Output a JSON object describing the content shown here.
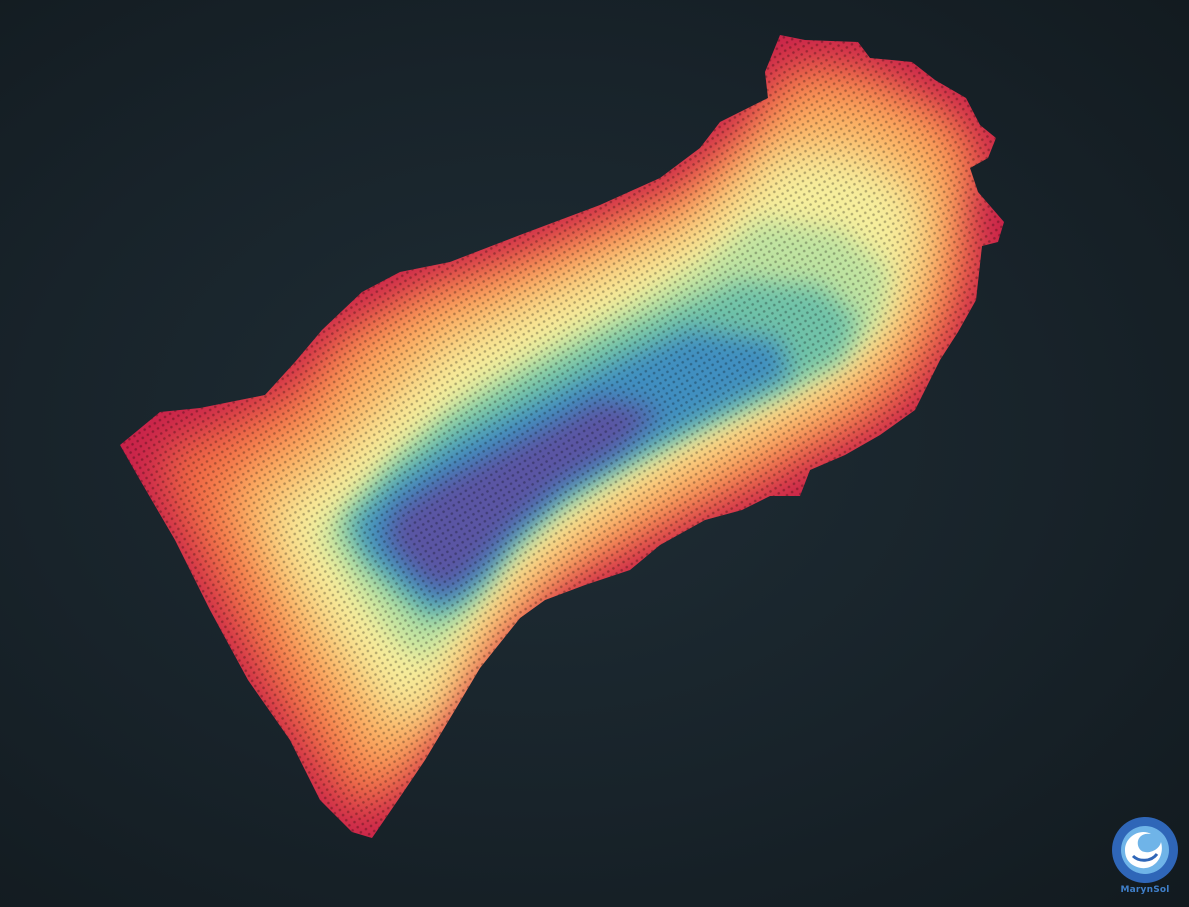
{
  "logo": {
    "name": "MarynSol",
    "colors": {
      "outer": "#2f66b8",
      "inner": "#6fb4e8",
      "wave": "#ffffff"
    }
  },
  "palette": {
    "background": "#1a232a",
    "scale": [
      "#5e4fa2",
      "#3288bd",
      "#66c2a5",
      "#abdda4",
      "#e6f598",
      "#fee08b",
      "#fdae61",
      "#f46d43",
      "#d53e4f",
      "#9e0142"
    ]
  }
}
